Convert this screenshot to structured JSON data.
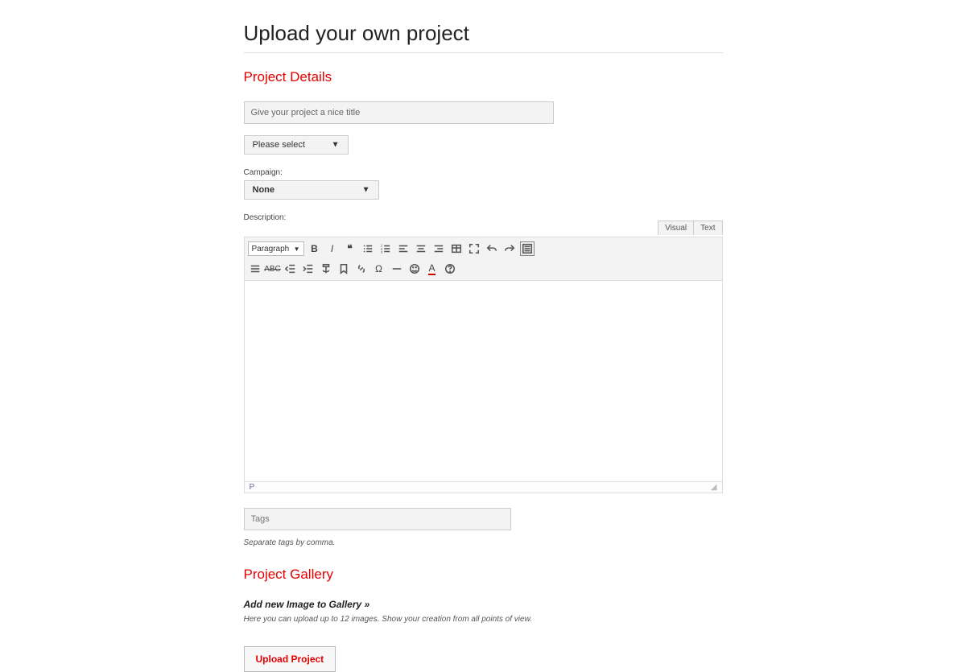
{
  "page": {
    "title": "Upload your own project"
  },
  "details": {
    "heading": "Project Details",
    "title_placeholder": "Give your project a nice title",
    "category_selected": "Please select",
    "campaign_label": "Campaign:",
    "campaign_selected": "None",
    "description_label": "Description:"
  },
  "editor": {
    "tab_visual": "Visual",
    "tab_text": "Text",
    "format_selected": "Paragraph",
    "status_path": "P"
  },
  "tags": {
    "placeholder": "Tags",
    "hint": "Separate tags by comma."
  },
  "gallery": {
    "heading": "Project Gallery",
    "add_link": "Add new Image to Gallery »",
    "hint": "Here you can upload up to 12 images. Show your creation from all points of view."
  },
  "submit": {
    "label": "Upload Project"
  }
}
